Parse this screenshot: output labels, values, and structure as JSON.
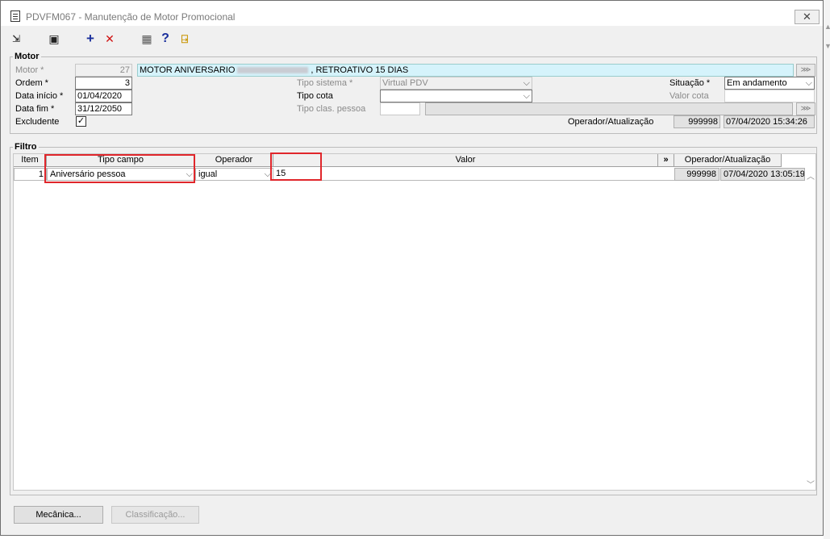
{
  "window": {
    "title": "PDVFM067 - Manutenção de Motor Promocional",
    "close_label": "✕"
  },
  "toolbar": {
    "items": [
      {
        "name": "exit-arrow-icon",
        "glyph": "⇲"
      },
      {
        "name": "save-icon",
        "glyph": "▣"
      },
      {
        "name": "add-icon",
        "glyph": "+"
      },
      {
        "name": "delete-icon",
        "glyph": "✕"
      },
      {
        "name": "calendar-grid-icon",
        "glyph": "▦"
      },
      {
        "name": "help-icon",
        "glyph": "?"
      },
      {
        "name": "door-exit-icon",
        "glyph": "⍈"
      }
    ]
  },
  "motor": {
    "group_label": "Motor",
    "motor_label": "Motor *",
    "motor_value": "27",
    "description_prefix": "MOTOR ANIVERSARIO",
    "description_suffix": ", RETROATIVO 15 DIAS",
    "ordem_label": "Ordem *",
    "ordem_value": "3",
    "data_inicio_label": "Data início *",
    "data_inicio_value": "01/04/2020",
    "data_fim_label": "Data fim *",
    "data_fim_value": "31/12/2050",
    "excludente_label": "Excludente",
    "excludente_checked": "✓",
    "tipo_sistema_label": "Tipo sistema *",
    "tipo_sistema_value": "Virtual PDV",
    "tipo_cota_label": "Tipo cota",
    "tipo_cota_value": "",
    "tipo_clas_label": "Tipo clas. pessoa",
    "tipo_clas_value": "",
    "situacao_label": "Situação *",
    "situacao_value": "Em andamento",
    "valor_cota_label": "Valor cota",
    "valor_cota_value": "",
    "operador_label": "Operador/Atualização",
    "operador_value": "999998",
    "atualizacao_value": "07/04/2020 15:34:26"
  },
  "filtro": {
    "group_label": "Filtro",
    "columns": {
      "item": "Item",
      "tipo_campo": "Tipo campo",
      "operador": "Operador",
      "valor": "Valor",
      "expand": "»",
      "operador_atualizacao": "Operador/Atualização"
    },
    "rows": [
      {
        "item": "1",
        "tipo_campo": "Aniversário pessoa",
        "operador": "igual",
        "valor": "15",
        "operador_id": "999998",
        "atualizacao": "07/04/2020 13:05:19"
      }
    ]
  },
  "buttons": {
    "mecanica": "Mecânica...",
    "classificacao": "Classificação..."
  },
  "colors": {
    "highlight_box": "#e0262b",
    "description_bg": "#d5f3fb"
  }
}
